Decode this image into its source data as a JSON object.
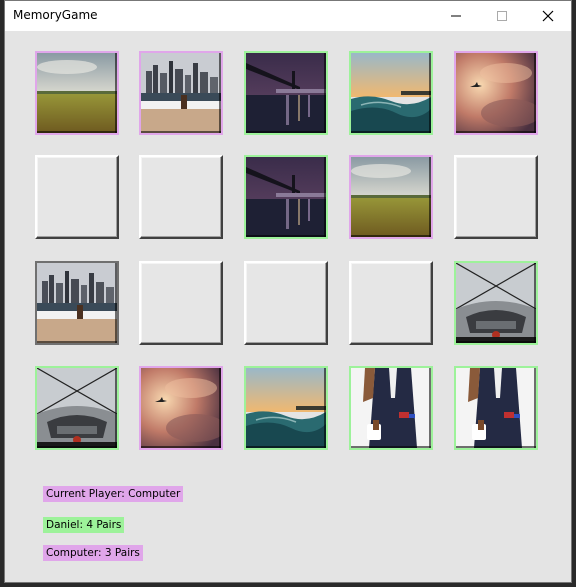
{
  "window": {
    "title": "MemoryGame"
  },
  "colors": {
    "player_a": "#9df29a",
    "player_b": "#e0a6ea",
    "background": "#e4e4e4"
  },
  "grid": [
    [
      "field",
      "city",
      "bridge",
      "sea",
      "sky"
    ],
    [
      "hidden",
      "hidden",
      "bridge",
      "field",
      "hidden"
    ],
    [
      "city",
      "hidden",
      "hidden",
      "hidden",
      "car"
    ],
    [
      "car",
      "sky",
      "sea",
      "suit",
      "suit"
    ]
  ],
  "owners": [
    [
      "purple",
      "purple",
      "green",
      "green",
      "purple"
    ],
    [
      "none",
      "none",
      "green",
      "purple",
      "none"
    ],
    [
      "none",
      "none",
      "none",
      "none",
      "green"
    ],
    [
      "green",
      "purple",
      "green",
      "green",
      "green"
    ]
  ],
  "status": {
    "current_player": "Current Player: Computer",
    "player1_score": "Daniel: 4 Pairs",
    "player2_score": "Computer: 3 Pairs"
  }
}
